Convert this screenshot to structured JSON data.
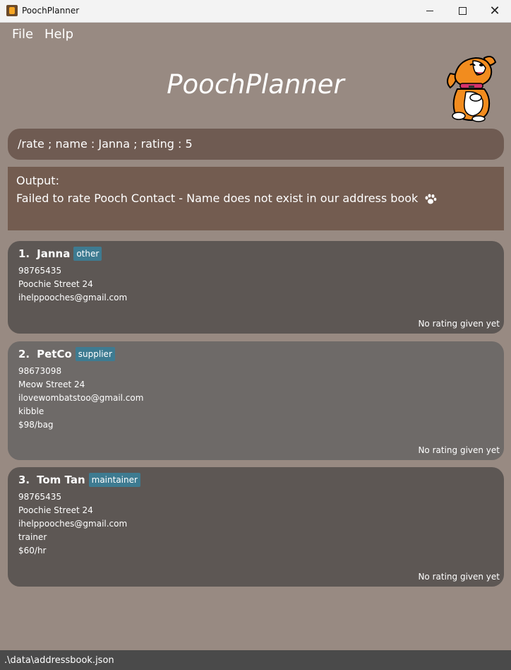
{
  "window": {
    "title": "PoochPlanner"
  },
  "menu": {
    "file": "File",
    "help": "Help"
  },
  "header": {
    "title": "PoochPlanner"
  },
  "command": {
    "text": "/rate ; name : Janna ; rating : 5"
  },
  "output": {
    "label": "Output:",
    "message": "Failed to rate Pooch Contact - Name does not exist in our address book"
  },
  "contacts": [
    {
      "index": "1.",
      "name": "Janna",
      "tag": "other",
      "lines": [
        "98765435",
        "Poochie Street 24",
        "ihelppooches@gmail.com"
      ],
      "rating": "No rating given yet"
    },
    {
      "index": "2.",
      "name": "PetCo",
      "tag": "supplier",
      "lines": [
        "98673098",
        "Meow Street 24",
        "ilovewombatstoo@gmail.com",
        "kibble",
        "$98/bag"
      ],
      "rating": "No rating given yet"
    },
    {
      "index": "3.",
      "name": "Tom Tan",
      "tag": "maintainer",
      "lines": [
        "98765435",
        "Poochie Street 24",
        "ihelppooches@gmail.com",
        "trainer",
        "$60/hr"
      ],
      "rating": "No rating given yet"
    }
  ],
  "status": {
    "path": ".\\data\\addressbook.json"
  },
  "icons": [
    "app-icon",
    "minimize-icon",
    "maximize-icon",
    "close-icon",
    "dog-logo-icon",
    "paw-icon"
  ]
}
